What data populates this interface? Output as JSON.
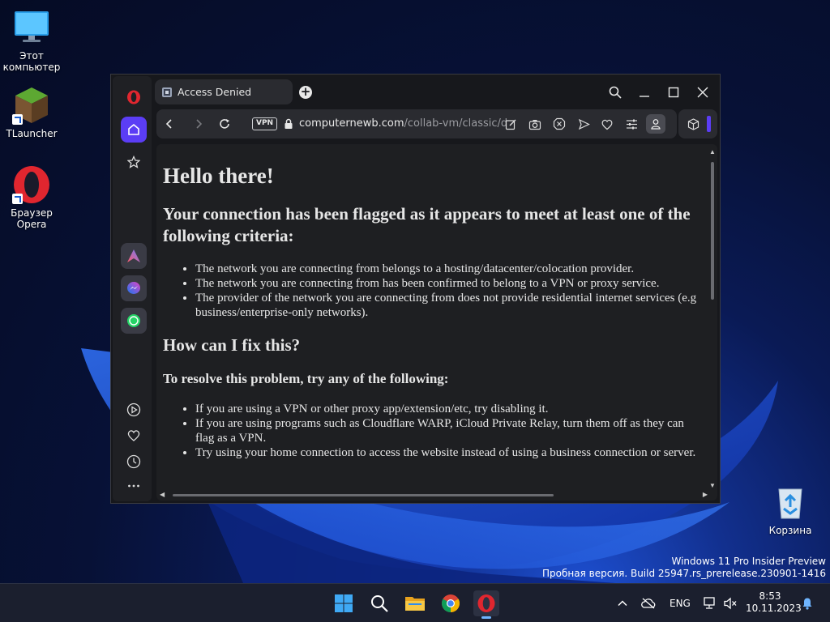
{
  "desktop": {
    "icons": [
      {
        "label": "Этот компьютер",
        "icon": "monitor-icon"
      },
      {
        "label": "TLauncher",
        "icon": "minecraft-block-icon"
      },
      {
        "label": "Браузер Opera",
        "icon": "opera-icon"
      },
      {
        "label": "Корзина",
        "icon": "recycle-bin-icon"
      }
    ],
    "watermark": {
      "line1": "Windows 11 Pro Insider Preview",
      "line2": "Пробная версия. Build 25947.rs_prerelease.230901-1416"
    }
  },
  "browser": {
    "tab_title": "Access Denied",
    "url_host": "computernewb.com",
    "url_path": "/collab-vm/classic/de",
    "vpn_badge": "VPN",
    "colors": {
      "accent": "#5b3df5",
      "opera_red": "#e0262f"
    }
  },
  "page": {
    "heading": "Hello there!",
    "flag_heading": "Your connection has been flagged as it appears to meet at least one of the following criteria:",
    "criteria": [
      "The network you are connecting from belongs to a hosting/datacenter/colocation provider.",
      "The network you are connecting from has been confirmed to belong to a VPN or proxy service.",
      "The provider of the network you are connecting from does not provide residential internet services (e.g business/enterprise-only networks)."
    ],
    "fix_heading": "How can I fix this?",
    "resolve_heading": "To resolve this problem, try any of the following:",
    "fixes": [
      "If you are using a VPN or other proxy app/extension/etc, try disabling it.",
      "If you are using programs such as Cloudflare WARP, iCloud Private Relay, turn them off as they can flag as a VPN.",
      "Try using your home connection to access the website instead of using a business connection or server."
    ]
  },
  "taskbar": {
    "language": "ENG",
    "time": "8:53",
    "date": "10.11.2023"
  }
}
